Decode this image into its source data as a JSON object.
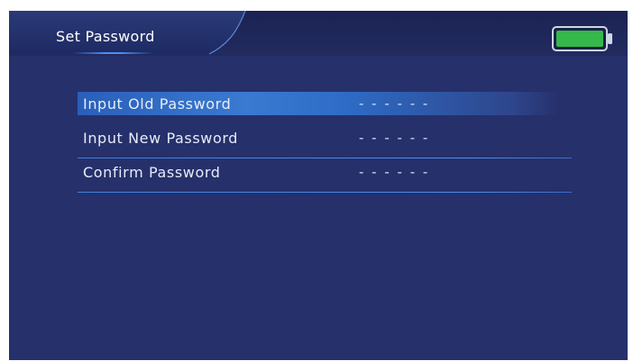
{
  "header": {
    "title": "Set Password",
    "battery_color": "#34b84a"
  },
  "menu": {
    "items": [
      {
        "label": "Input Old Password",
        "value": "- - - - - -",
        "selected": true
      },
      {
        "label": "Input New Password",
        "value": "- - - - - -",
        "selected": false
      },
      {
        "label": "Confirm Password",
        "value": "- - - - - -",
        "selected": false
      }
    ]
  },
  "colors": {
    "background": "#26306b",
    "highlight": "#3a7ad0",
    "divider": "#4a8ff0"
  }
}
